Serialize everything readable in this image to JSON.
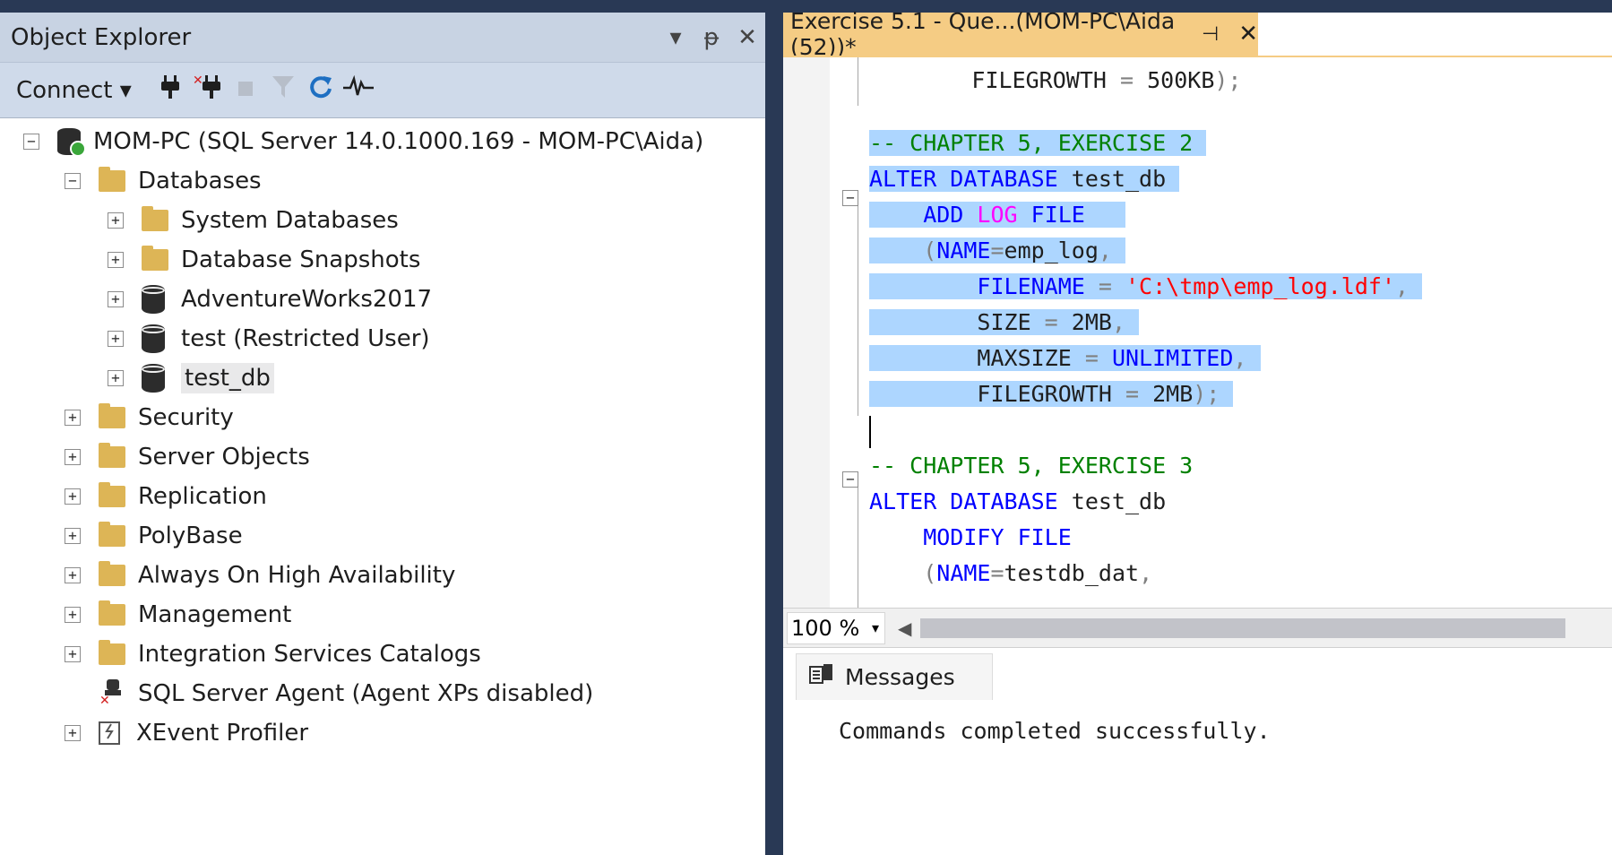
{
  "object_explorer": {
    "title": "Object Explorer",
    "title_controls": {
      "dropdown": "▾",
      "pin": "ᵽ",
      "close": "✕"
    },
    "toolbar": {
      "connect_label": "Connect ▾",
      "icons": [
        "connect-plug-icon",
        "disconnect-plug-icon",
        "stop-icon",
        "filter-icon",
        "refresh-icon",
        "activity-monitor-icon"
      ]
    },
    "tree": {
      "server": "MOM-PC (SQL Server 14.0.1000.169 - MOM-PC\\Aida)",
      "databases": "Databases",
      "system_databases": "System Databases",
      "database_snapshots": "Database Snapshots",
      "adventureworks": "AdventureWorks2017",
      "test": "test (Restricted User)",
      "test_db": "test_db",
      "security": "Security",
      "server_objects": "Server Objects",
      "replication": "Replication",
      "polybase": "PolyBase",
      "always_on": "Always On High Availability",
      "management": "Management",
      "integration_services": "Integration Services Catalogs",
      "sql_agent": "SQL Server Agent (Agent XPs disabled)",
      "xevent": "XEvent Profiler"
    },
    "expanders": {
      "collapsed": "+",
      "expanded": "−"
    }
  },
  "query_editor": {
    "tab_title": "Exercise 5.1 - Que...(MOM-PC\\Aida (52))*",
    "tab_pin": "⊣",
    "tab_close": "✕",
    "fold_collapse": "−",
    "code": {
      "l0_indent": "        ",
      "l0_a": "FILEGROWTH ",
      "l0_b": "= ",
      "l0_c": "500KB",
      "l0_d": ");",
      "l2": "-- CHAPTER 5, EXERCISE 2",
      "l3_a": "ALTER DATABASE ",
      "l3_b": "test_db",
      "l4_a": "    ADD ",
      "l4_b": "LOG ",
      "l4_c": "FILE",
      "l5_a": "    (",
      "l5_b": "NAME",
      "l5_c": "=",
      "l5_d": "emp_log",
      "l5_e": ",",
      "l6_a": "        FILENAME ",
      "l6_b": "= ",
      "l6_c": "'C:\\tmp\\emp_log.ldf'",
      "l6_d": ",",
      "l7_a": "        SIZE ",
      "l7_b": "= ",
      "l7_c": "2MB",
      "l7_d": ",",
      "l8_a": "        MAXSIZE ",
      "l8_b": "= ",
      "l8_c": "UNLIMITED",
      "l8_d": ",",
      "l9_a": "        FILEGROWTH ",
      "l9_b": "= ",
      "l9_c": "2MB",
      "l9_d": ");",
      "l11": "-- CHAPTER 5, EXERCISE 3",
      "l12_a": "ALTER DATABASE ",
      "l12_b": "test_db",
      "l13": "    MODIFY FILE",
      "l14_a": "    (",
      "l14_b": "NAME",
      "l14_c": "=",
      "l14_d": "testdb_dat",
      "l14_e": ","
    },
    "zoom": "100 %",
    "zoom_arrow": "▾",
    "scroll_left": "◀",
    "messages_tab": "Messages",
    "message_text": "Commands completed successfully."
  },
  "colors": {
    "background": "#293955",
    "selection": "#add6ff",
    "keyword": "#0000ff",
    "comment": "#008000",
    "string": "#ff0000",
    "function": "#ff00ff",
    "active_tab": "#f5cc84"
  }
}
